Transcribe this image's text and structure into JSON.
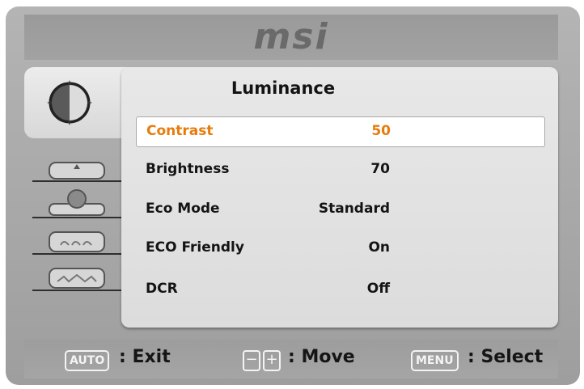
{
  "brand": "msi",
  "menu": {
    "title": "Luminance",
    "items": [
      {
        "label": "Contrast",
        "value": "50",
        "selected": true
      },
      {
        "label": "Brightness",
        "value": "70",
        "selected": false
      },
      {
        "label": "Eco Mode",
        "value": "Standard",
        "selected": false
      },
      {
        "label": "ECO Friendly",
        "value": "On",
        "selected": false
      },
      {
        "label": "DCR",
        "value": "Off",
        "selected": false
      }
    ]
  },
  "tabs": [
    {
      "icon": "luminance-icon",
      "active": true
    },
    {
      "icon": "image-setup-icon",
      "active": false
    },
    {
      "icon": "color-temp-icon",
      "active": false
    },
    {
      "icon": "osd-setup-icon",
      "active": false
    },
    {
      "icon": "extra-icon",
      "active": false
    }
  ],
  "footer": {
    "auto_key": "AUTO",
    "auto_text": ": Exit",
    "minus_key": "−",
    "plus_key": "+",
    "move_text": ": Move",
    "menu_key": "MENU",
    "select_text": ": Select"
  },
  "colors": {
    "selected_text": "#e77c0c",
    "panel": "#e4e4e4",
    "frame": "#a8a8a8"
  }
}
